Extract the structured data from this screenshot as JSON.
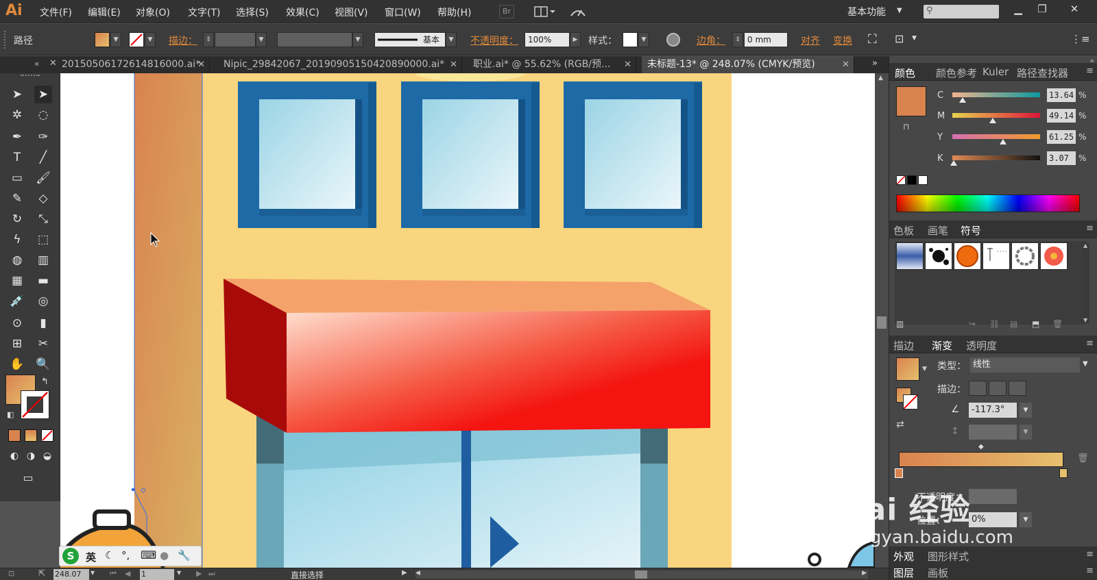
{
  "app": {
    "logo": "Ai",
    "menu": [
      "文件(F)",
      "编辑(E)",
      "对象(O)",
      "文字(T)",
      "选择(S)",
      "效果(C)",
      "视图(V)",
      "窗口(W)",
      "帮助(H)"
    ],
    "bridge_label": "Br",
    "workspace": "基本功能",
    "window_controls": [
      "minimize-icon",
      "restore-icon",
      "close-icon"
    ]
  },
  "control_bar": {
    "selection_type": "路径",
    "fill_color": "#d9834f",
    "stroke_label": "描边：",
    "stroke_style": "基本",
    "opacity_label": "不透明度：",
    "opacity_value": "100%",
    "style_label": "样式：",
    "corner_label": "边角：",
    "corner_value": "0 mm",
    "align_label": "对齐",
    "transform_label": "变换"
  },
  "tabs": [
    {
      "label": "20150506172614816000.ai*",
      "active": false
    },
    {
      "label": "Nipic_29842067_20190905150420890000.ai*",
      "active": false
    },
    {
      "label": "职业.ai* @ 55.62% (RGB/预...",
      "active": false
    },
    {
      "label": "未标题-13* @ 248.07% (CMYK/预览)",
      "active": true
    }
  ],
  "tools": [
    "selection-tool",
    "direct-selection-tool",
    "magic-wand-tool",
    "lasso-tool",
    "pen-tool",
    "curvature-tool",
    "type-tool",
    "line-tool",
    "rectangle-tool",
    "paintbrush-tool",
    "pencil-tool",
    "eraser-tool",
    "rotate-tool",
    "scale-tool",
    "warp-tool",
    "free-transform-tool",
    "shape-builder-tool",
    "graph-tool",
    "mesh-tool",
    "gradient-tool",
    "eyedropper-tool",
    "blend-tool",
    "symbol-sprayer-tool",
    "column-graph-tool",
    "artboard-tool",
    "slice-tool",
    "hand-tool",
    "zoom-tool"
  ],
  "colors": {
    "fill": "#d9834f",
    "gradient_start": "#d9834f",
    "gradient_end": "#e6c06e",
    "wall": "#f8d57e",
    "window_frame": "#1e6aa6",
    "awning_red": "#f41410",
    "awning_dark": "#a80a0a",
    "awning_top": "#f5a26a",
    "glass": "#a9d8e6"
  },
  "status_bar": {
    "zoom": "248.07",
    "page": "1",
    "tool_name": "直接选择"
  },
  "color_panel": {
    "tabs": [
      "颜色",
      "颜色参考",
      "Kuler",
      "路径查找器"
    ],
    "sliders": [
      {
        "label": "C",
        "value": "13.64",
        "pct": 13.64,
        "unit": "%"
      },
      {
        "label": "M",
        "value": "49.14",
        "pct": 49.14,
        "unit": "%"
      },
      {
        "label": "Y",
        "value": "61.25",
        "pct": 61.25,
        "unit": "%"
      },
      {
        "label": "K",
        "value": "3.07",
        "pct": 3.07,
        "unit": "%"
      }
    ]
  },
  "swatch_panel": {
    "tabs": [
      "色板",
      "画笔",
      "符号"
    ]
  },
  "gradient_panel": {
    "tabs": [
      "描边",
      "渐变",
      "透明度"
    ],
    "type_label": "类型：",
    "type_value": "线性",
    "stroke_label": "描边：",
    "angle_value": "-117.3°",
    "opacity_label": "不透明度：",
    "location_label": "位置：",
    "location_value": "0%"
  },
  "bottom_panels": {
    "tabs1": [
      "外观",
      "图形样式"
    ],
    "tabs2": [
      "图层",
      "画板"
    ]
  },
  "ime": {
    "logo": "S",
    "lang": "英"
  },
  "watermark": {
    "text": "Bai 经验",
    "url": "jingyan.baidu.com"
  }
}
